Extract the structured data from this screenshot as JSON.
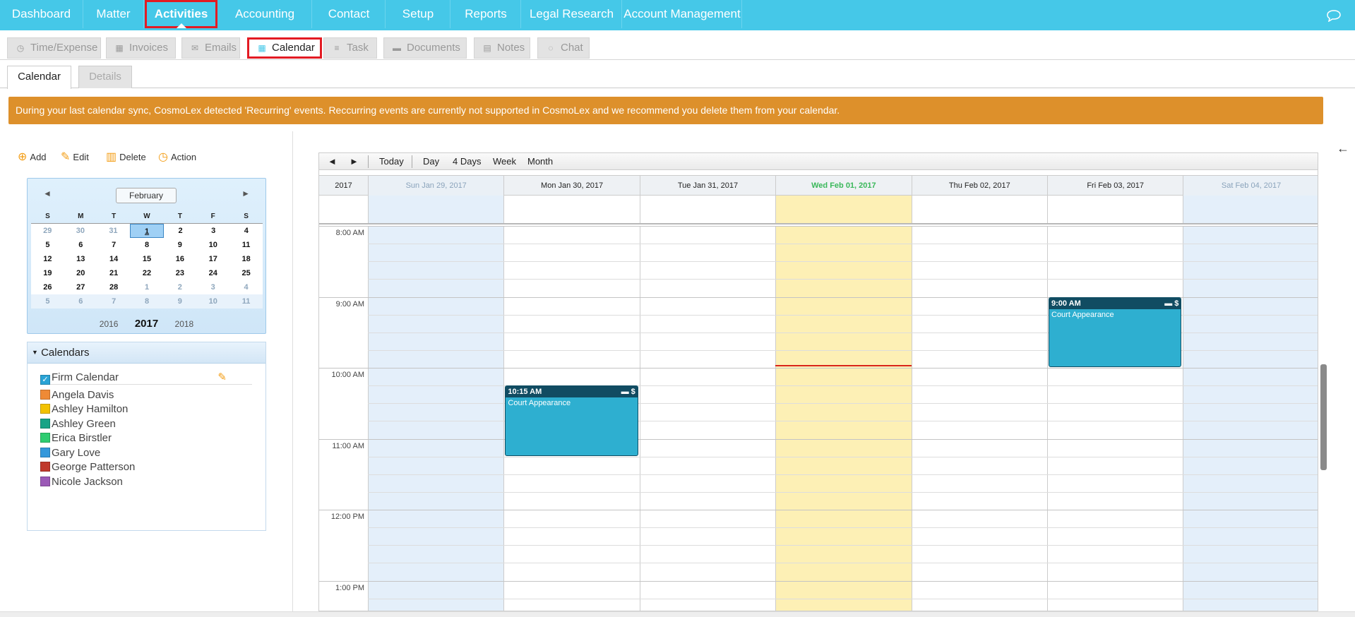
{
  "top_nav": {
    "items": [
      "Dashboard",
      "Matter",
      "Activities",
      "Accounting",
      "Contact",
      "Setup",
      "Reports",
      "Legal Research",
      "Account Management"
    ],
    "active": "Activities"
  },
  "sub_tabs": {
    "items": [
      {
        "label": "Time/Expense",
        "icon": "clock-icon"
      },
      {
        "label": "Invoices",
        "icon": "calculator-icon"
      },
      {
        "label": "Emails",
        "icon": "envelope-icon"
      },
      {
        "label": "Calendar",
        "icon": "calendar-icon"
      },
      {
        "label": "Task",
        "icon": "list-icon"
      },
      {
        "label": "Documents",
        "icon": "folder-icon"
      },
      {
        "label": "Notes",
        "icon": "note-icon"
      },
      {
        "label": "Chat",
        "icon": "chat-icon"
      }
    ],
    "active": "Calendar"
  },
  "page_tabs": {
    "calendar": "Calendar",
    "details": "Details"
  },
  "banner": "During your last calendar sync, CosmoLex detected 'Recurring' events. Reccurring events are currently not supported in CosmoLex and we recommend you delete them from your calendar.",
  "actions": {
    "add": "Add",
    "edit": "Edit",
    "delete": "Delete",
    "action": "Action"
  },
  "mini_calendar": {
    "month": "February",
    "weekdays": [
      "S",
      "M",
      "T",
      "W",
      "T",
      "F",
      "S"
    ],
    "weeks": [
      [
        "29",
        "30",
        "31",
        "1",
        "2",
        "3",
        "4"
      ],
      [
        "5",
        "6",
        "7",
        "8",
        "9",
        "10",
        "11"
      ],
      [
        "12",
        "13",
        "14",
        "15",
        "16",
        "17",
        "18"
      ],
      [
        "19",
        "20",
        "21",
        "22",
        "23",
        "24",
        "25"
      ],
      [
        "26",
        "27",
        "28",
        "1",
        "2",
        "3",
        "4"
      ],
      [
        "5",
        "6",
        "7",
        "8",
        "9",
        "10",
        "11"
      ]
    ],
    "years": [
      "2016",
      "2017",
      "2018"
    ]
  },
  "calendars": {
    "title": "Calendars",
    "items": [
      {
        "name": "Firm Calendar",
        "color": "#2aa3d5"
      },
      {
        "name": "Angela Davis",
        "color": "#ef8a36"
      },
      {
        "name": "Ashley Hamilton",
        "color": "#f2c200"
      },
      {
        "name": "Ashley Green",
        "color": "#17a386"
      },
      {
        "name": "Erica Birstler",
        "color": "#2ecc71"
      },
      {
        "name": "Gary Love",
        "color": "#3498db"
      },
      {
        "name": "George Patterson",
        "color": "#c0392b"
      },
      {
        "name": "Nicole Jackson",
        "color": "#9b59b6"
      }
    ]
  },
  "toolbar": {
    "prev": "◄",
    "next": "►",
    "today": "Today",
    "day": "Day",
    "four_days": "4 Days",
    "week": "Week",
    "month": "Month"
  },
  "grid": {
    "year": "2017",
    "days": [
      "Sun Jan 29, 2017",
      "Mon Jan 30, 2017",
      "Tue Jan 31, 2017",
      "Wed Feb 01, 2017",
      "Thu Feb 02, 2017",
      "Fri Feb 03, 2017",
      "Sat Feb 04, 2017"
    ],
    "times": [
      "8:00 AM",
      "9:00 AM",
      "10:00 AM",
      "11:00 AM",
      "12:00 PM",
      "1:00 PM"
    ],
    "events": [
      {
        "time": "10:15 AM",
        "title": "Court Appearance",
        "icons": "▬ $"
      },
      {
        "time": "9:00 AM",
        "title": "Court Appearance",
        "icons": "▬ $"
      }
    ]
  }
}
